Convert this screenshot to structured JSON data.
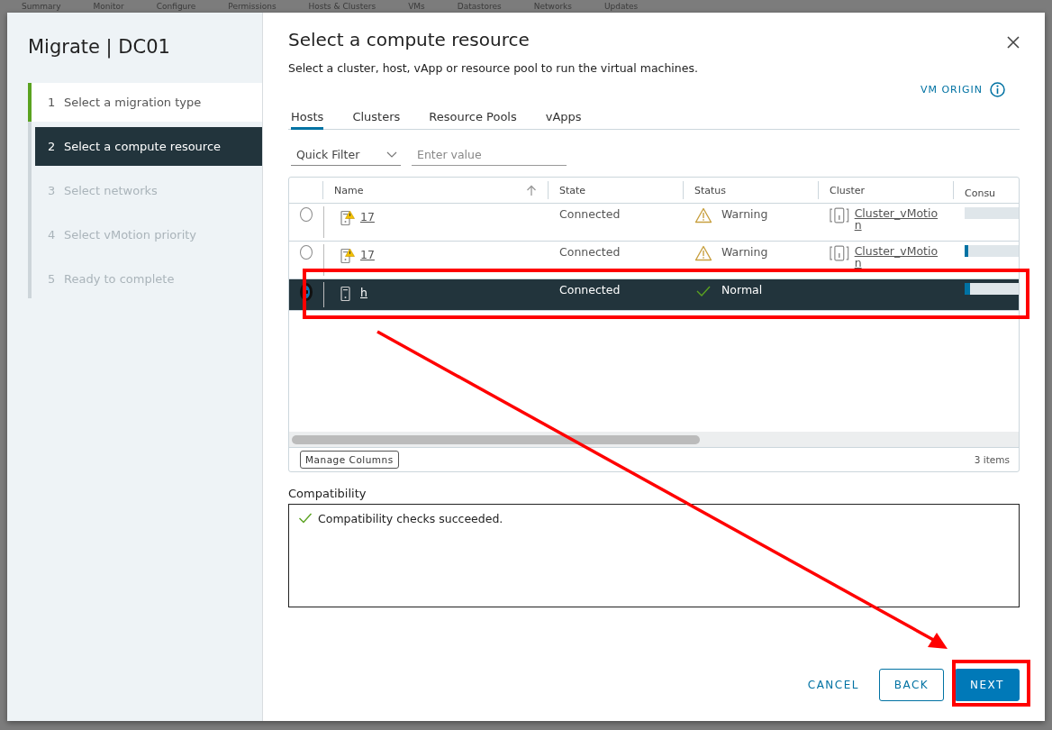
{
  "background_tabs": [
    "Summary",
    "Monitor",
    "Configure",
    "Permissions",
    "Hosts & Clusters",
    "VMs",
    "Datastores",
    "Networks",
    "Updates"
  ],
  "dialog": {
    "title": "Migrate | DC01",
    "steps": [
      {
        "number": "1",
        "label": "Select a migration type",
        "completed": true,
        "selected": false,
        "disabled": false
      },
      {
        "number": "2",
        "label": "Select a compute resource",
        "completed": false,
        "selected": true,
        "disabled": false
      },
      {
        "number": "3",
        "label": "Select networks",
        "completed": false,
        "selected": false,
        "disabled": true
      },
      {
        "number": "4",
        "label": "Select vMotion priority",
        "completed": false,
        "selected": false,
        "disabled": true
      },
      {
        "number": "5",
        "label": "Ready to complete",
        "completed": false,
        "selected": false,
        "disabled": true
      }
    ],
    "heading": "Select a compute resource",
    "subtitle": "Select a cluster, host, vApp or resource pool to run the virtual machines.",
    "vm_origin_link": "VM ORIGIN",
    "tabs": [
      {
        "label": "Hosts",
        "selected": true
      },
      {
        "label": "Clusters",
        "selected": false
      },
      {
        "label": "Resource Pools",
        "selected": false
      },
      {
        "label": "vApps",
        "selected": false
      }
    ],
    "filter": {
      "label": "Quick Filter",
      "placeholder": "Enter value"
    },
    "table": {
      "columns": [
        "Name",
        "State",
        "Status",
        "Cluster",
        "Consu"
      ],
      "rows": [
        {
          "selected": false,
          "alert": true,
          "name": "17",
          "state": "Connected",
          "kind": "warning",
          "status": "Warning",
          "cluster": "Cluster_vMotion"
        },
        {
          "selected": false,
          "alert": true,
          "name": "17",
          "state": "Connected",
          "kind": "warning",
          "status": "Warning",
          "cluster": "Cluster_vMotion",
          "level": 0.06
        },
        {
          "selected": true,
          "alert": false,
          "name": "h",
          "state": "Connected",
          "kind": "normal",
          "status": "Normal",
          "level": 0.1
        }
      ],
      "manage_columns": "Manage Columns",
      "count": "3 items"
    },
    "compatibility": {
      "label": "Compatibility",
      "message": "Compatibility checks succeeded."
    },
    "buttons": {
      "cancel": "CANCEL",
      "back": "BACK",
      "next": "NEXT"
    }
  }
}
